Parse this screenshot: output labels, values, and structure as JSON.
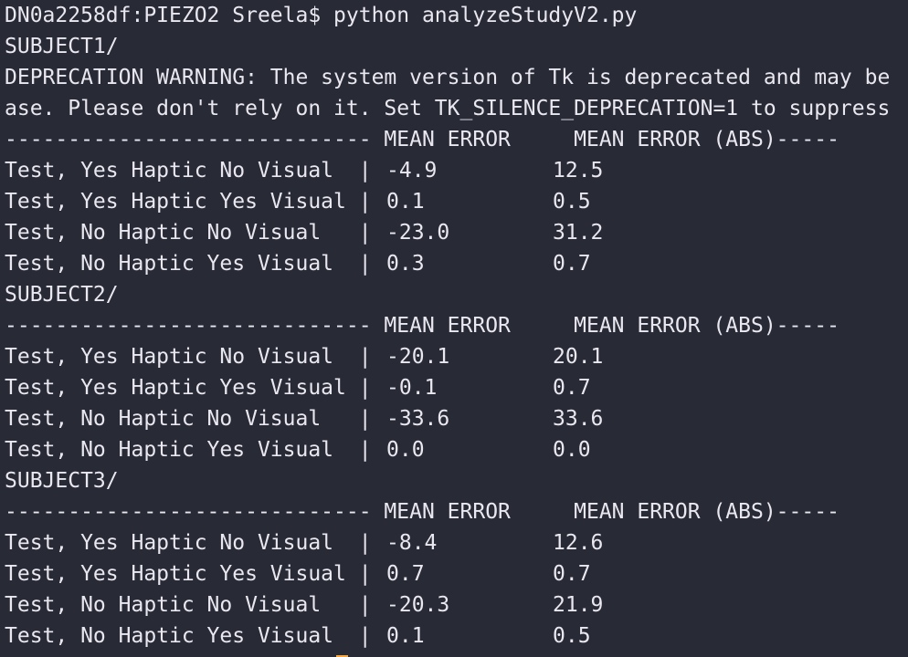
{
  "terminal": {
    "colors": {
      "background": "#282a36",
      "foreground": "#e9e7ef",
      "cursor": "#f5a742"
    },
    "prompt": "DN0a2258df:PIEZO2 Sreela$ python analyzeStudyV2.py",
    "first_subject": "SUBJECT1/",
    "warning_line1": "DEPRECATION WARNING: The system version of Tk is deprecated and may be",
    "warning_line2": "ase. Please don't rely on it. Set TK_SILENCE_DEPRECATION=1 to suppress",
    "blocks": [
      {
        "header": "----------------------------- MEAN ERROR     MEAN ERROR (ABS)-----",
        "rows": [
          {
            "label": "Test, Yes Haptic No Visual  | ",
            "mean_error": "-4.9",
            "mean_error_abs": "12.5"
          },
          {
            "label": "Test, Yes Haptic Yes Visual | ",
            "mean_error": "0.1",
            "mean_error_abs": "0.5"
          },
          {
            "label": "Test, No Haptic No Visual   | ",
            "mean_error": "-23.0",
            "mean_error_abs": "31.2"
          },
          {
            "label": "Test, No Haptic Yes Visual  | ",
            "mean_error": "0.3",
            "mean_error_abs": "0.7"
          }
        ],
        "next": "SUBJECT2/"
      },
      {
        "header": "----------------------------- MEAN ERROR     MEAN ERROR (ABS)-----",
        "rows": [
          {
            "label": "Test, Yes Haptic No Visual  | ",
            "mean_error": "-20.1",
            "mean_error_abs": "20.1"
          },
          {
            "label": "Test, Yes Haptic Yes Visual | ",
            "mean_error": "-0.1",
            "mean_error_abs": "0.7"
          },
          {
            "label": "Test, No Haptic No Visual   | ",
            "mean_error": "-33.6",
            "mean_error_abs": "33.6"
          },
          {
            "label": "Test, No Haptic Yes Visual  | ",
            "mean_error": "0.0",
            "mean_error_abs": "0.0"
          }
        ],
        "next": "SUBJECT3/"
      },
      {
        "header": "----------------------------- MEAN ERROR     MEAN ERROR (ABS)-----",
        "rows": [
          {
            "label": "Test, Yes Haptic No Visual  | ",
            "mean_error": "-8.4",
            "mean_error_abs": "12.6"
          },
          {
            "label": "Test, Yes Haptic Yes Visual | ",
            "mean_error": "0.7",
            "mean_error_abs": "0.7"
          },
          {
            "label": "Test, No Haptic No Visual   | ",
            "mean_error": "-20.3",
            "mean_error_abs": "21.9"
          },
          {
            "label": "Test, No Haptic Yes Visual  | ",
            "mean_error": "0.1",
            "mean_error_abs": "0.5"
          }
        ],
        "next": null
      }
    ]
  }
}
